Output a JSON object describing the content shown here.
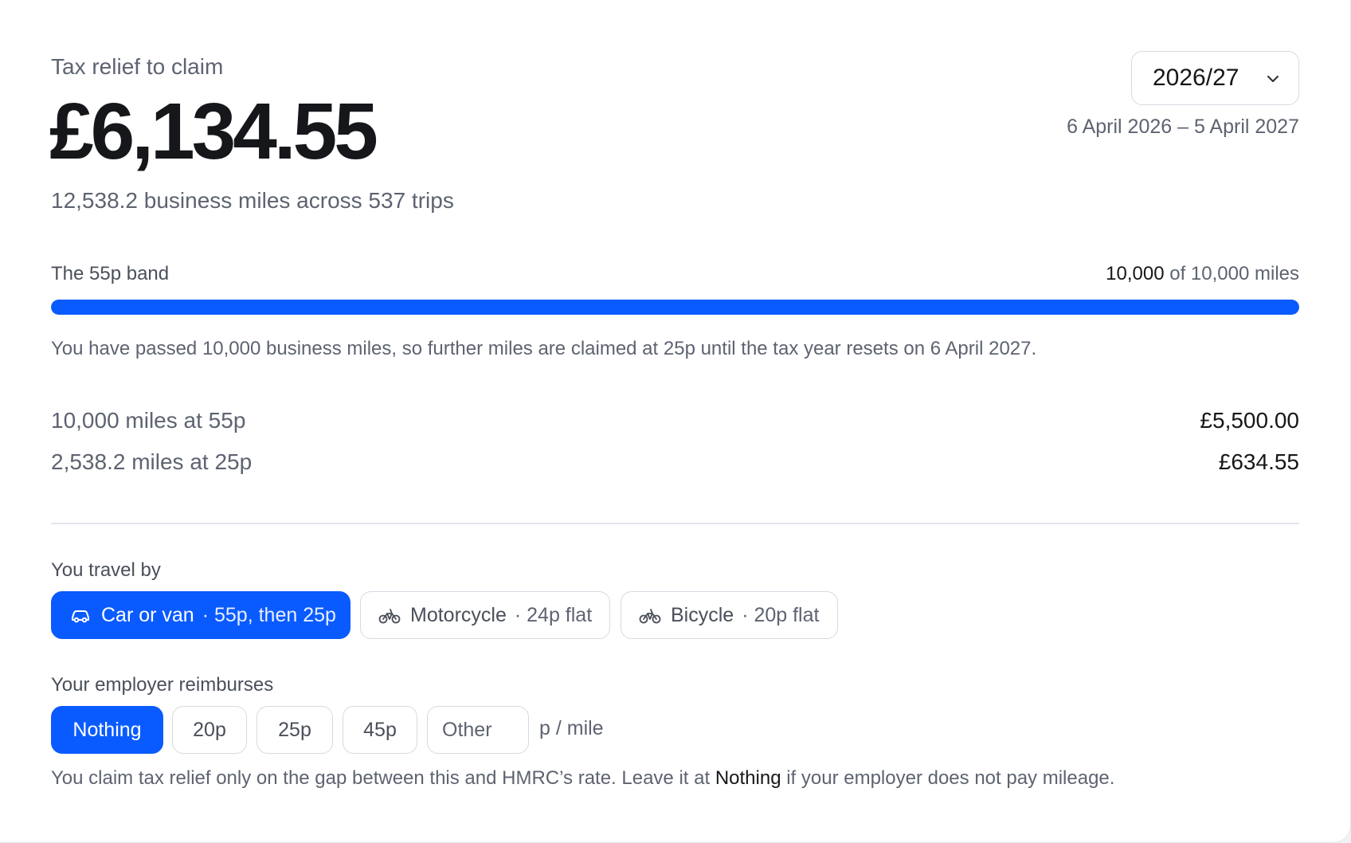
{
  "header": {
    "eyebrow": "Tax relief to claim",
    "amount": "£6,134.55",
    "summary": "12,538.2 business miles across 537 trips"
  },
  "tax_year": {
    "selected": "2026/27",
    "range": "6 April 2026 – 5 April 2027"
  },
  "band": {
    "label": "The 55p band",
    "used": "10,000",
    "of_text": "of 10,000 miles",
    "progress_fraction": 1.0,
    "note": "You have passed 10,000 business miles, so further miles are claimed at 25p until the tax year resets on 6 April 2027."
  },
  "breakdown": [
    {
      "label": "10,000 miles at 55p",
      "value": "£5,500.00"
    },
    {
      "label": "2,538.2 miles at 25p",
      "value": "£634.55"
    }
  ],
  "travel": {
    "label": "You travel by",
    "modes": [
      {
        "name": "Car or van",
        "rate": "· 55p, then 25p",
        "icon": "car-icon",
        "active": true
      },
      {
        "name": "Motorcycle",
        "rate": "· 24p flat",
        "icon": "bike-icon",
        "active": false
      },
      {
        "name": "Bicycle",
        "rate": "· 20p flat",
        "icon": "bike-icon",
        "active": false
      }
    ]
  },
  "employer": {
    "label": "Your employer reimburses",
    "options": [
      "Nothing",
      "20p",
      "25p",
      "45p"
    ],
    "selected": "Nothing",
    "other_placeholder": "Other",
    "unit": "p / mile",
    "footer_before": "You claim tax relief only on the gap between this and HMRC’s rate. Leave it at ",
    "footer_strong": "Nothing",
    "footer_after": " if your employer does not pay mileage."
  },
  "colors": {
    "accent": "#0a5bff",
    "text_primary": "#16171a",
    "text_secondary": "#5d6370",
    "border": "#d6dae2"
  }
}
